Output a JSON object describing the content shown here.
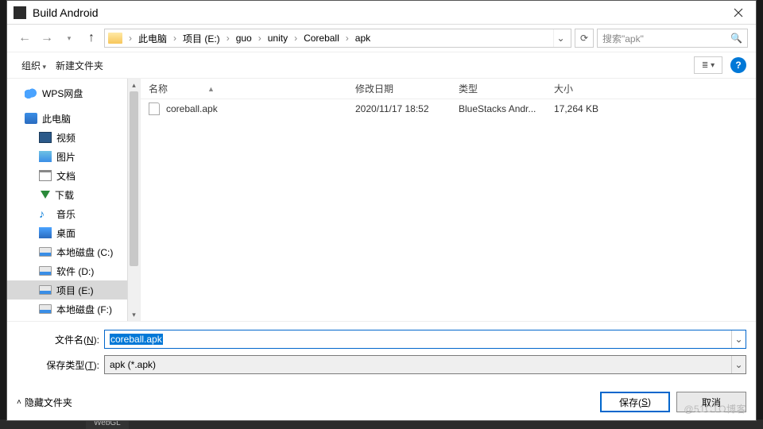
{
  "window": {
    "title": "Build Android"
  },
  "breadcrumbs": [
    "此电脑",
    "项目 (E:)",
    "guo",
    "unity",
    "Coreball",
    "apk"
  ],
  "search": {
    "placeholder": "搜索\"apk\""
  },
  "toolbar": {
    "organize": "组织",
    "new_folder": "新建文件夹"
  },
  "columns": {
    "name": "名称",
    "date": "修改日期",
    "type": "类型",
    "size": "大小"
  },
  "sidebar": {
    "items": [
      {
        "label": "WPS网盘",
        "icon": "cloud"
      },
      {
        "label": "此电脑",
        "icon": "pc"
      },
      {
        "label": "视频",
        "icon": "vid",
        "sub": true
      },
      {
        "label": "图片",
        "icon": "img",
        "sub": true
      },
      {
        "label": "文档",
        "icon": "doc",
        "sub": true
      },
      {
        "label": "下载",
        "icon": "dl",
        "sub": true
      },
      {
        "label": "音乐",
        "icon": "music",
        "sub": true
      },
      {
        "label": "桌面",
        "icon": "desk",
        "sub": true
      },
      {
        "label": "本地磁盘 (C:)",
        "icon": "disk",
        "sub": true
      },
      {
        "label": "软件 (D:)",
        "icon": "disk",
        "sub": true
      },
      {
        "label": "项目 (E:)",
        "icon": "disk",
        "sub": true,
        "selected": true
      },
      {
        "label": "本地磁盘 (F:)",
        "icon": "disk",
        "sub": true
      }
    ]
  },
  "files": [
    {
      "name": "coreball.apk",
      "date": "2020/11/17 18:52",
      "type": "BlueStacks Andr...",
      "size": "17,264 KB"
    }
  ],
  "fields": {
    "filename_label_pre": "文件名(",
    "filename_label_u": "N",
    "filename_label_post": "):",
    "filename_value": "coreball.apk",
    "savetype_label_pre": "保存类型(",
    "savetype_label_u": "T",
    "savetype_label_post": "):",
    "savetype_value": "apk (*.apk)"
  },
  "footer": {
    "hide_folders": "隐藏文件夹",
    "save_pre": "保存(",
    "save_u": "S",
    "save_post": ")",
    "cancel": "取消"
  },
  "watermark": "@51CTO博客",
  "back_tab": "WebGL"
}
